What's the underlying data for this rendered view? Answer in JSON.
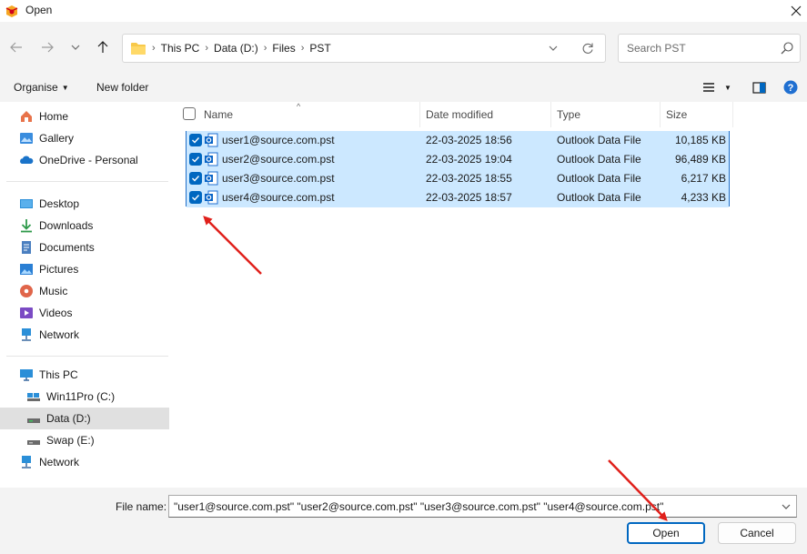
{
  "window": {
    "title": "Open",
    "close_label": "✕"
  },
  "navigation": {
    "breadcrumb": [
      "This PC",
      "Data (D:)",
      "Files",
      "PST"
    ],
    "search_placeholder": "Search PST"
  },
  "commands": {
    "organise": "Organise",
    "new_folder": "New folder"
  },
  "sidebar": {
    "quick": [
      {
        "label": "Home",
        "icon": "home-icon"
      },
      {
        "label": "Gallery",
        "icon": "gallery-icon"
      },
      {
        "label": "OneDrive - Personal",
        "icon": "cloud-icon"
      }
    ],
    "pinned": [
      {
        "label": "Desktop",
        "icon": "desktop-icon"
      },
      {
        "label": "Downloads",
        "icon": "download-icon"
      },
      {
        "label": "Documents",
        "icon": "documents-icon"
      },
      {
        "label": "Pictures",
        "icon": "pictures-icon"
      },
      {
        "label": "Music",
        "icon": "music-icon"
      },
      {
        "label": "Videos",
        "icon": "videos-icon"
      },
      {
        "label": "Network",
        "icon": "network-icon"
      }
    ],
    "this_pc": "This PC",
    "drives": [
      {
        "label": "Win11Pro (C:)",
        "icon": "drive-icon"
      },
      {
        "label": "Data (D:)",
        "icon": "drive-icon",
        "selected": true
      },
      {
        "label": "Swap (E:)",
        "icon": "drive-icon"
      }
    ],
    "network": "Network"
  },
  "columns": {
    "name": "Name",
    "date": "Date modified",
    "type": "Type",
    "size": "Size"
  },
  "files": [
    {
      "name": "user1@source.com.pst",
      "date": "22-03-2025 18:56",
      "type": "Outlook Data File",
      "size": "10,185 KB",
      "checked": true
    },
    {
      "name": "user2@source.com.pst",
      "date": "22-03-2025 19:04",
      "type": "Outlook Data File",
      "size": "96,489 KB",
      "checked": true
    },
    {
      "name": "user3@source.com.pst",
      "date": "22-03-2025 18:55",
      "type": "Outlook Data File",
      "size": "6,217 KB",
      "checked": true
    },
    {
      "name": "user4@source.com.pst",
      "date": "22-03-2025 18:57",
      "type": "Outlook Data File",
      "size": "4,233 KB",
      "checked": true
    }
  ],
  "footer": {
    "filename_label": "File name:",
    "filename_value": "\"user1@source.com.pst\" \"user2@source.com.pst\" \"user3@source.com.pst\" \"user4@source.com.pst\"",
    "open_label": "Open",
    "cancel_label": "Cancel"
  },
  "colors": {
    "accent": "#0067c0",
    "selection": "#cce8ff",
    "annotation_arrow": "#e0201b"
  }
}
